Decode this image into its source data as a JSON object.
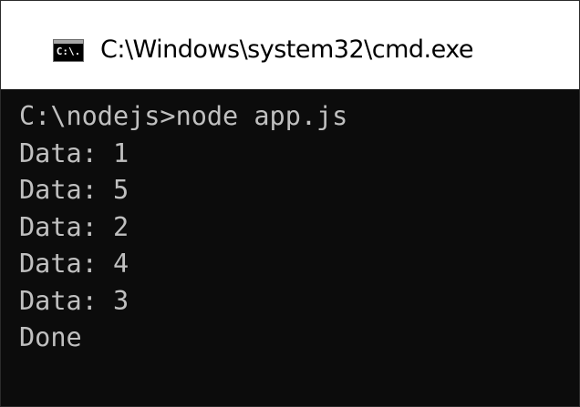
{
  "window": {
    "title": "C:\\Windows\\system32\\cmd.exe",
    "icon": "cmd-icon",
    "icon_text": "C:\\."
  },
  "console": {
    "lines": [
      "C:\\nodejs>node app.js",
      "Data: 1",
      "Data: 5",
      "Data: 2",
      "Data: 4",
      "Data: 3",
      "Done"
    ]
  },
  "colors": {
    "console_background": "#0c0c0c",
    "console_text": "#c0c0c0",
    "titlebar_background": "#ffffff"
  }
}
